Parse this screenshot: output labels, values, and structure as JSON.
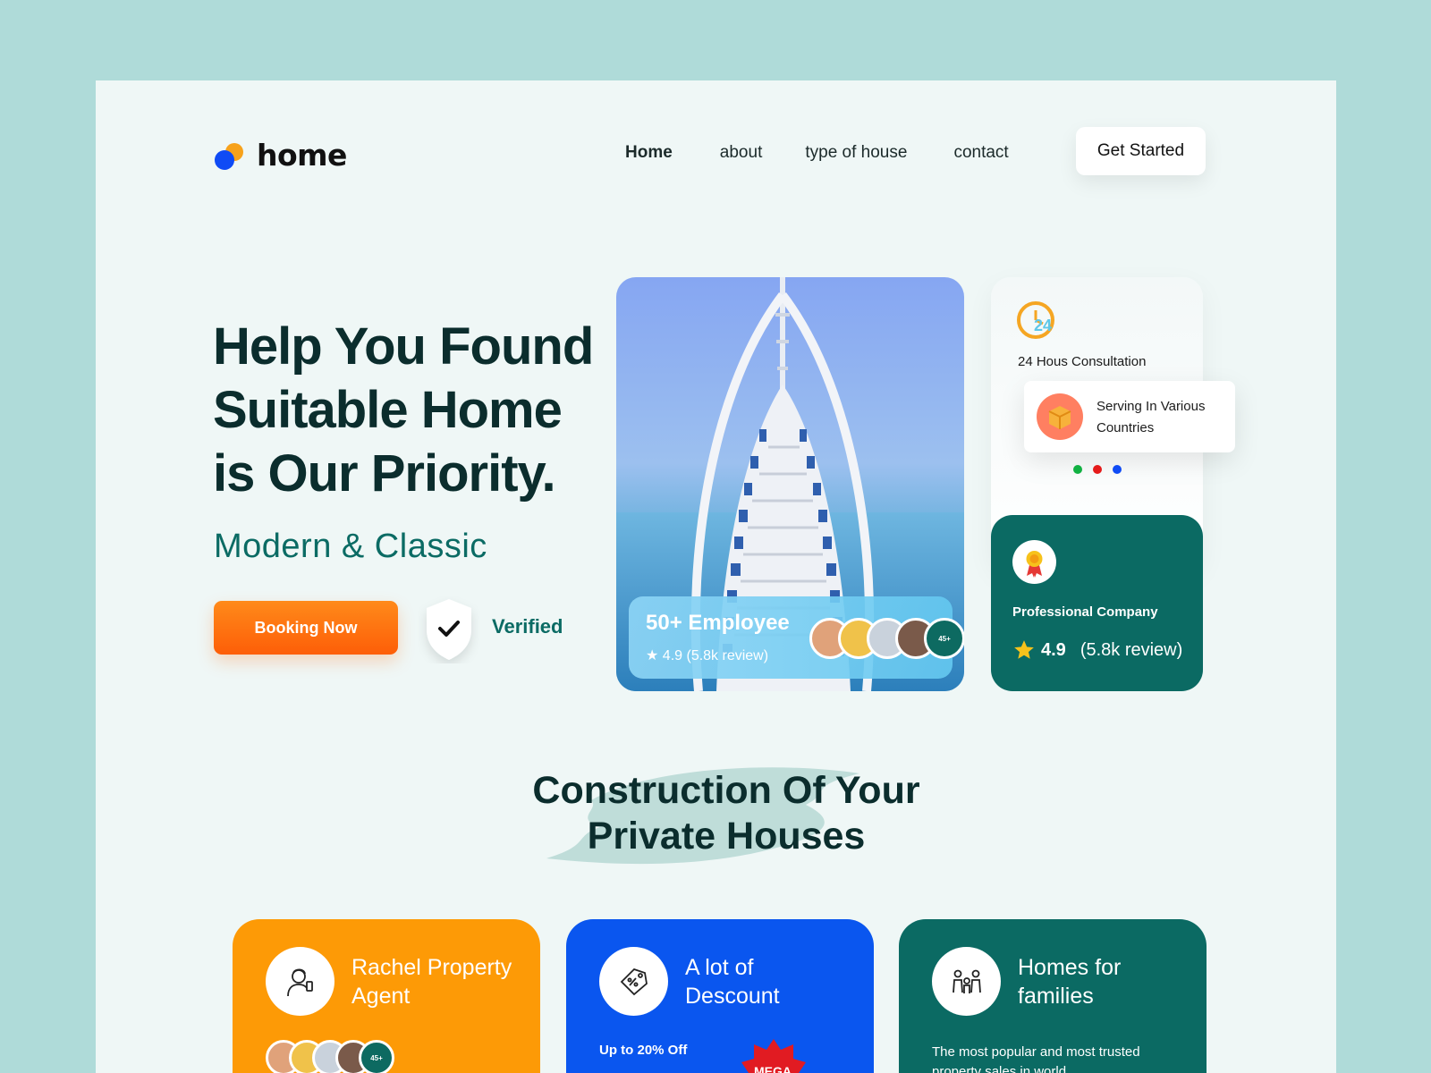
{
  "brand": {
    "name": "home"
  },
  "nav": {
    "items": [
      "Home",
      "about",
      "type of house",
      "contact"
    ],
    "cta": "Get Started"
  },
  "hero": {
    "title_lines": [
      "Help You Found",
      "Suitable Home",
      "is Our Priority."
    ],
    "subtitle": "Modern & Classic",
    "booking_button": "Booking Now",
    "verified_label": "Verified"
  },
  "employee_card": {
    "title": "50+ Employee",
    "rating": "4.9 (5.8k review)",
    "more_badge": "45+"
  },
  "consultation_card": {
    "title": "24 Hous Consultation",
    "clock_badge": "24"
  },
  "serving_card": {
    "line1": "Serving In Various",
    "line2": "Countries"
  },
  "pager_dots": [
    "#11b142",
    "#e51a1a",
    "#0f4bf5"
  ],
  "professional_card": {
    "title": "Professional Company",
    "score": "4.9",
    "reviews": "(5.8k review)"
  },
  "section": {
    "title_lines": [
      "Construction Of Your",
      "Private Houses"
    ]
  },
  "features": [
    {
      "title_lines": [
        "Rachel Property",
        "Agent"
      ],
      "more_badge": "45+"
    },
    {
      "title_lines": [
        "A lot of",
        "Descount"
      ],
      "note": "Up to 20% Off",
      "sticker": "MEGA"
    },
    {
      "title_lines": [
        "Homes for",
        "families"
      ],
      "desc": "The most popular and most trusted property sales in world"
    }
  ],
  "colors": {
    "accent_orange": "#fd9a06",
    "accent_blue": "#0a56ef",
    "accent_green": "#0b6a63",
    "background": "#eff7f6"
  }
}
